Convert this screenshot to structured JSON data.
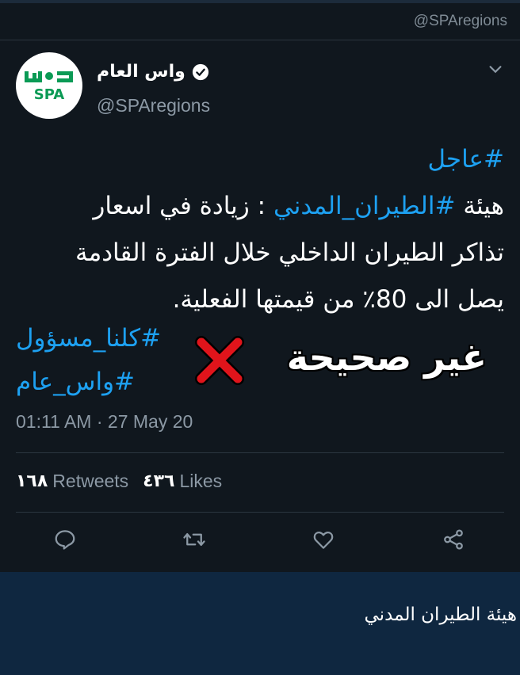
{
  "watermark": "@SPAregions",
  "account": {
    "display_name": "واس العام",
    "handle": "@SPAregions",
    "logo_text": "SPA",
    "verified": true
  },
  "tweet": {
    "line1_tag": "#عاجل",
    "line2_pre": "هيئة ",
    "line2_tag": "#الطيران_المدني",
    "line2_post": " :  زيادة في اسعار",
    "line3": "تذاكر الطيران الداخلي خلال الفترة القادمة",
    "line4": "يصل الى 80٪ من قيمتها الفعلية.",
    "hashtags": [
      "#كلنا_مسؤول",
      "#واس_عام"
    ],
    "timestamp": "01:11 AM · 27 May 20"
  },
  "stats": {
    "retweets_count": "١٦٨",
    "retweets_label": "Retweets",
    "likes_count": "٤٣٦",
    "likes_label": "Likes"
  },
  "stamp": {
    "text": "غير صحيحة",
    "icon": "red-x-icon"
  },
  "actions": [
    "reply-icon",
    "retweet-icon",
    "like-icon",
    "share-icon"
  ],
  "caption": "هيئة الطيران المدني",
  "colors": {
    "background": "#10171e",
    "page_background": "#0f2740",
    "link": "#1da1f2",
    "muted": "#8c99a5",
    "brand_green": "#0b9a55",
    "x_red": "#e0141b"
  }
}
